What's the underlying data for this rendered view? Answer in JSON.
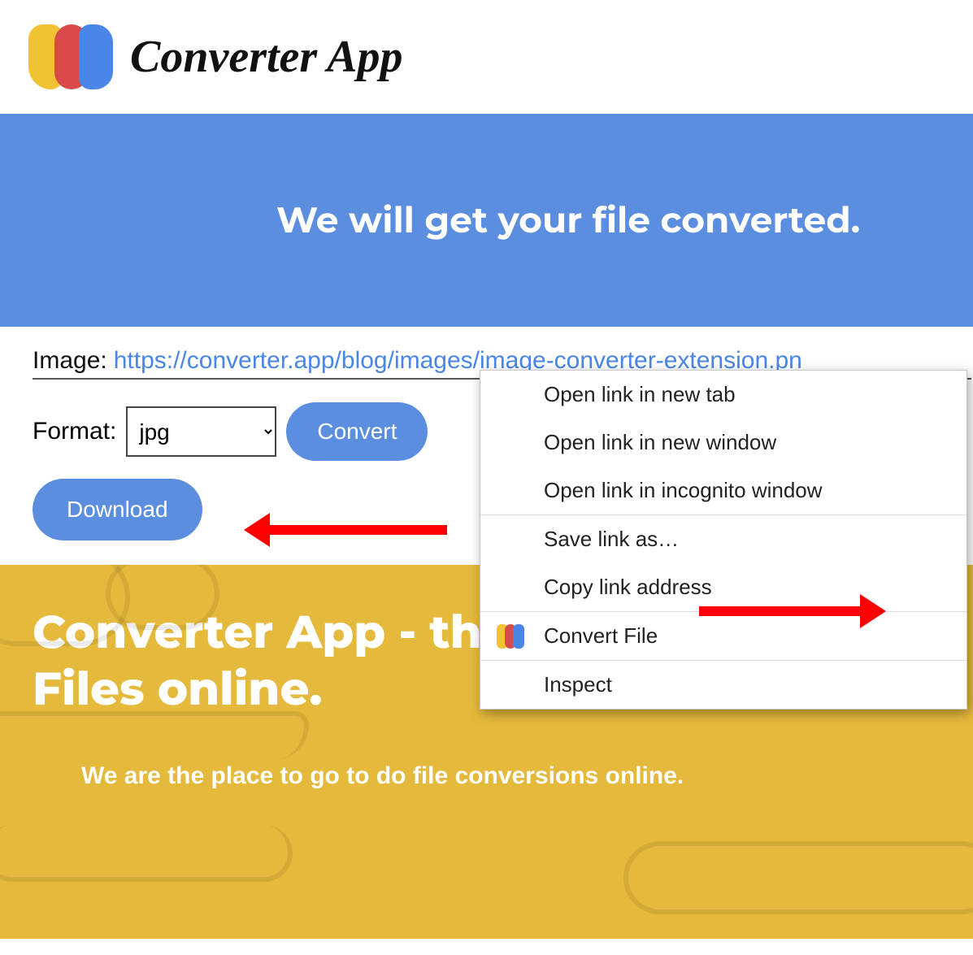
{
  "header": {
    "logo_text": "Converter App"
  },
  "hero": {
    "headline": "We will get your file converted."
  },
  "panel": {
    "image_label": "Image:",
    "image_url": "https://converter.app/blog/images/image-converter-extension.pn",
    "format_label": "Format:",
    "format_value": "jpg",
    "convert_label": "Convert",
    "download_label": "Download"
  },
  "hero2": {
    "title": "Converter App - the place to convert Files online.",
    "subtitle": "We are the place to go to do file conversions online."
  },
  "context_menu": {
    "items": [
      "Open link in new tab",
      "Open link in new window",
      "Open link in incognito window",
      "Save link as…",
      "Copy link address",
      "Convert File",
      "Inspect"
    ]
  }
}
